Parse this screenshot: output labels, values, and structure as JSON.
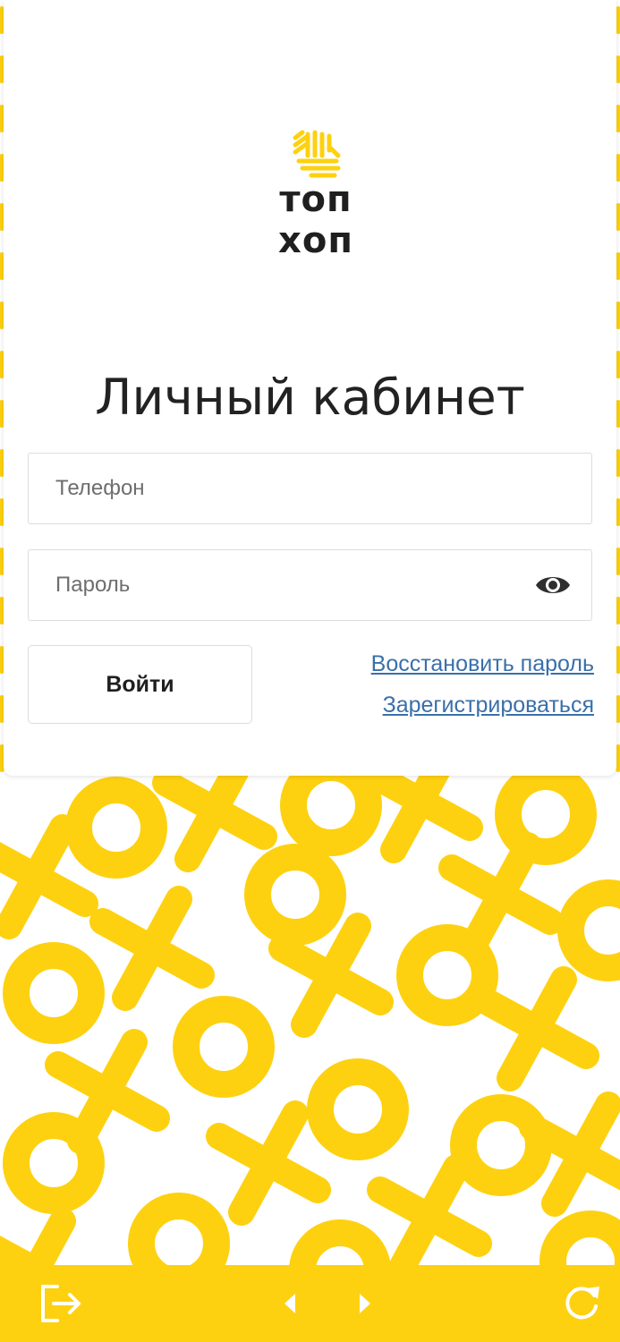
{
  "brand": {
    "logo_text": "топ хоп",
    "accent_color": "#fdd110"
  },
  "login": {
    "title": "Личный кабинет",
    "phone_placeholder": "Телефон",
    "password_placeholder": "Пароль",
    "show_password_icon": "eye-icon",
    "login_button": "Войти",
    "restore_password_link": "Восстановить пароль",
    "register_link": "Зарегистрироваться",
    "link_color": "#3a6faa"
  },
  "bottom_bar": {
    "exit_icon": "logout-icon",
    "back_icon": "arrow-left-icon",
    "forward_icon": "arrow-right-icon",
    "reload_icon": "reload-icon"
  }
}
